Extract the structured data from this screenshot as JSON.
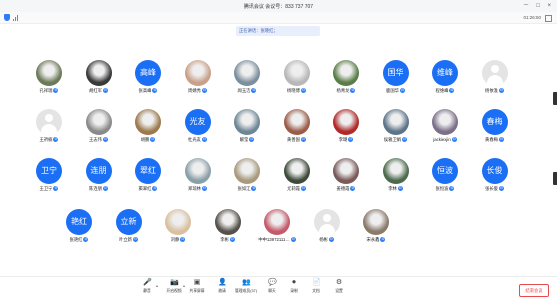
{
  "window": {
    "title": "腾讯会议  会议号：833 737 707",
    "controls": [
      "－",
      "□",
      "×"
    ]
  },
  "topbar": {
    "timer": "01:26:50"
  },
  "speaker_banner": "正在讲话：张晓红；",
  "participants": [
    {
      "name": "孔祥瑞",
      "avatar": "photo",
      "color": "#6c7a5a"
    },
    {
      "name": "胡红军",
      "avatar": "photo",
      "color": "#3a3a3a"
    },
    {
      "name": "张高峰",
      "avatar": "text",
      "label": "高峰"
    },
    {
      "name": "周婧秀",
      "avatar": "photo",
      "color": "#c9a089"
    },
    {
      "name": "闻玉洁",
      "avatar": "photo",
      "color": "#7c8f9e"
    },
    {
      "name": "杨晓博",
      "avatar": "photo",
      "color": "#b8b8b8"
    },
    {
      "name": "杨青龙",
      "avatar": "photo",
      "color": "#5a7d4a"
    },
    {
      "name": "鹿国华",
      "avatar": "text",
      "label": "国华"
    },
    {
      "name": "程维峰",
      "avatar": "text",
      "label": "维峰"
    },
    {
      "name": "杨依淮",
      "avatar": "user"
    },
    {
      "name": "王祈楠",
      "avatar": "user"
    },
    {
      "name": "王志伟",
      "avatar": "photo",
      "color": "#8a8a8a"
    },
    {
      "name": "胡鹏",
      "avatar": "photo",
      "color": "#9c7a4e"
    },
    {
      "name": "杜光友",
      "avatar": "text",
      "label": "光友"
    },
    {
      "name": "解莹",
      "avatar": "photo",
      "color": "#6d8796"
    },
    {
      "name": "黄善国",
      "avatar": "photo",
      "color": "#9c5c4a"
    },
    {
      "name": "李璐",
      "avatar": "photo",
      "color": "#b02a2a"
    },
    {
      "name": "侯雅卫娟",
      "avatar": "photo",
      "color": "#5c7489"
    },
    {
      "name": "jackiexjin",
      "avatar": "photo",
      "color": "#7b6f8a"
    },
    {
      "name": "黄春梅",
      "avatar": "text",
      "label": "春梅"
    },
    {
      "name": "王卫宁",
      "avatar": "text",
      "label": "卫宁"
    },
    {
      "name": "陈连朋",
      "avatar": "text",
      "label": "连朋"
    },
    {
      "name": "窦翠红",
      "avatar": "text",
      "label": "翠红"
    },
    {
      "name": "郑琼林",
      "avatar": "photo",
      "color": "#8aa0a8"
    },
    {
      "name": "张如江",
      "avatar": "photo",
      "color": "#a89a7c"
    },
    {
      "name": "尤莉霞",
      "avatar": "photo",
      "color": "#3e4a3a"
    },
    {
      "name": "姜德霞",
      "avatar": "photo",
      "color": "#7a5a5a"
    },
    {
      "name": "李林",
      "avatar": "photo",
      "color": "#4d6a4d"
    },
    {
      "name": "张恒波",
      "avatar": "text",
      "label": "恒波"
    },
    {
      "name": "张长俊",
      "avatar": "text",
      "label": "长俊"
    },
    {
      "name": "张艳红",
      "avatar": "text",
      "label": "艳红"
    },
    {
      "name": "叶立新",
      "avatar": "text",
      "label": "立新"
    },
    {
      "name": "刘静",
      "avatar": "photo",
      "color": "#d9c0a0"
    },
    {
      "name": "李彬",
      "avatar": "photo",
      "color": "#55504a"
    },
    {
      "name": "中中13972111…",
      "avatar": "photo",
      "color": "#c45a6a"
    },
    {
      "name": "杨彬",
      "avatar": "user"
    },
    {
      "name": "宋永鑫",
      "avatar": "photo",
      "color": "#8a7a6a"
    }
  ],
  "toolbar": [
    {
      "label": "静音",
      "icon": "microphone-icon",
      "glyph": "🎤"
    },
    {
      "label": "开启视频",
      "icon": "camera-icon",
      "glyph": "📷"
    },
    {
      "label": "共享屏幕",
      "icon": "screen-share-icon",
      "glyph": "▣"
    },
    {
      "label": "邀请",
      "icon": "invite-icon",
      "glyph": "👤"
    },
    {
      "label": "管理成员(37)",
      "icon": "members-icon",
      "glyph": "👥"
    },
    {
      "label": "聊天",
      "icon": "chat-icon",
      "glyph": "💬"
    },
    {
      "label": "录制",
      "icon": "record-icon",
      "glyph": "⏺"
    },
    {
      "label": "文档",
      "icon": "document-icon",
      "glyph": "📄"
    },
    {
      "label": "设置",
      "icon": "settings-icon",
      "glyph": "⚙"
    }
  ],
  "end_meeting": "结束会议",
  "colors": {
    "accent": "#1b6ff5",
    "danger": "#e94b4b",
    "mic": "#2f7ef7"
  }
}
